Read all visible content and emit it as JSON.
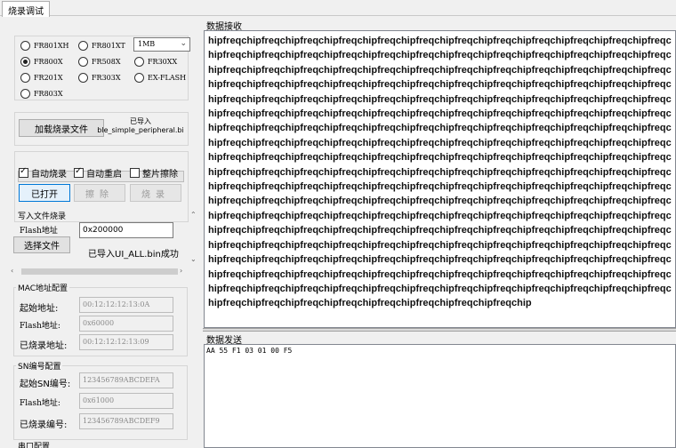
{
  "tab": {
    "label": "烧录调试"
  },
  "chips": {
    "options": [
      "FR801XH",
      "FR801XT",
      "FR800X",
      "FR508X",
      "FR30XX",
      "FR201X",
      "FR303X",
      "EX-FLASH",
      "FR803X"
    ],
    "selected": "FR800X",
    "flash_size": "1MB"
  },
  "load": {
    "button": "加载烧录文件",
    "status_line1": "已导入",
    "status_line2": "ble_simple_peripheral.bi"
  },
  "progress": {
    "value": 0
  },
  "options": {
    "auto_burn": "自动烧录",
    "auto_burn_checked": true,
    "auto_restart": "自动重启",
    "auto_restart_checked": true,
    "full_erase": "整片擦除",
    "full_erase_checked": false
  },
  "actions": {
    "open": "已打开",
    "erase": "擦除",
    "burn": "烧录"
  },
  "write_file": {
    "title": "写入文件烧录",
    "flash_addr_label": "Flash地址",
    "flash_addr_value": "0x200000",
    "select_button": "选择文件",
    "status": "已导入UI_ALL.bin成功"
  },
  "mac": {
    "title": "MAC地址配置",
    "start_label": "起始地址:",
    "start_value": "00:12:12:12:13:0A",
    "flash_label": "Flash地址:",
    "flash_value": "0x60000",
    "burned_label": "已烧录地址:",
    "burned_value": "00:12:12:12:13:09"
  },
  "sn": {
    "title": "SN编号配置",
    "start_label": "起始SN编号:",
    "start_value": "123456789ABCDEFA",
    "flash_label": "Flash地址:",
    "flash_value": "0x61000",
    "burned_label": "已烧录编号:",
    "burned_value": "123456789ABCDEF9"
  },
  "serial": {
    "title": "串口配置"
  },
  "receive": {
    "title": "数据接收",
    "content": "hipfreqchipfreqchipfreqchipfreqchipfreqchipfreqchipfreqchipfreqchipfreqchipfreqchipfreqchipfreqchipfreqchipfreqchipfreqchipfreqchipfreqchipfreqchipfreqchipfreqchipfreqchipfreqchipfreqchipfreqchipfreqchipfreqchipfreqchipfreqchipfreqchipfreqchipfreqchipfreqchipfreqchipfreqchipfreqchipfreqchipfreqchipfreqchipfreqchipfreqchipfreqchipfreqchipfreqchipfreqchipfreqchipfreqchipfreqchipfreqchipfreqchipfreqchipfreqchipfreqchipfreqchipfreqchipfreqchipfreqchipfreqchipfreqchipfreqchipfreqchipfreqchipfreqchipfreqchipfreqchipfreqchipfreqchipfreqchipfreqchipfreqchipfreqchipfreqchipfreqchipfreqchipfreqchipfreqchipfreqchipfreqchipfreqchipfreqchipfreqchipfreqchipfreqchipfreqchipfreqchipfreqchipfreqchipfreqchipfreqchipfreqchipfreqchipfreqchipfreqchipfreqchipfreqchipfreqchipfreqchipfreqchipfreqchipfreqchipfreqchipfreqchipfreqchipfreqchipfreqchipfreqchipfreqchipfreqchipfreqchipfreqchipfreqchipfreqchipfreqchipfreqchipfreqchipfreqchipfreqchipfreqchipfreqchipfreqchipfreqchipfreqchipfreqchipfreqchipfreqchipfreqchipfreqchipfreqchipfreqchipfreqchipfreqchipfreqchipfreqchipfreqchipfreqchipfreqchipfreqchipfreqchipfreqchipfreqchipfreqchipfreqchipfreqchipfreqchipfreqchipfreqchipfreqchipfreqchipfreqchipfreqchipfreqchipfreqchipfreqchipfreqchipfreqchipfreqchipfreqchipfreqchipfreqchipfreqchipfreqchipfreqchipfreqchipfreqchipfreqchipfreqchipfreqchipfreqchipfreqchipfreqchipfreqchipfreqchipfreqchipfreqchipfreqchipfreqchipfreqchipfreqchipfreqchipfreqchipfreqchipfreqchipfreqchipfreqchipfreqchipfreqchipfreqchipfreqchipfreqchipfreqchipfreqchipfreqchipfreqchipfreqchipfreqchipfreqchipfreqchipfreqchipfreqchipfreqchipfreqchipfreqchipfreqchipfreqchipfreqchipfreqchipfreqchipfreqchipfreqchipfreqchipfreqchipfreqchipfreqchipfreqchipfreqchipfreqchipfreqchipfreqchipfreqchipfreqchipfreqchipfreqchipfreqchipfreqchipfreqchip"
  },
  "send": {
    "title": "数据发送",
    "content": "AA 55 F1 03 01 00 F5"
  }
}
